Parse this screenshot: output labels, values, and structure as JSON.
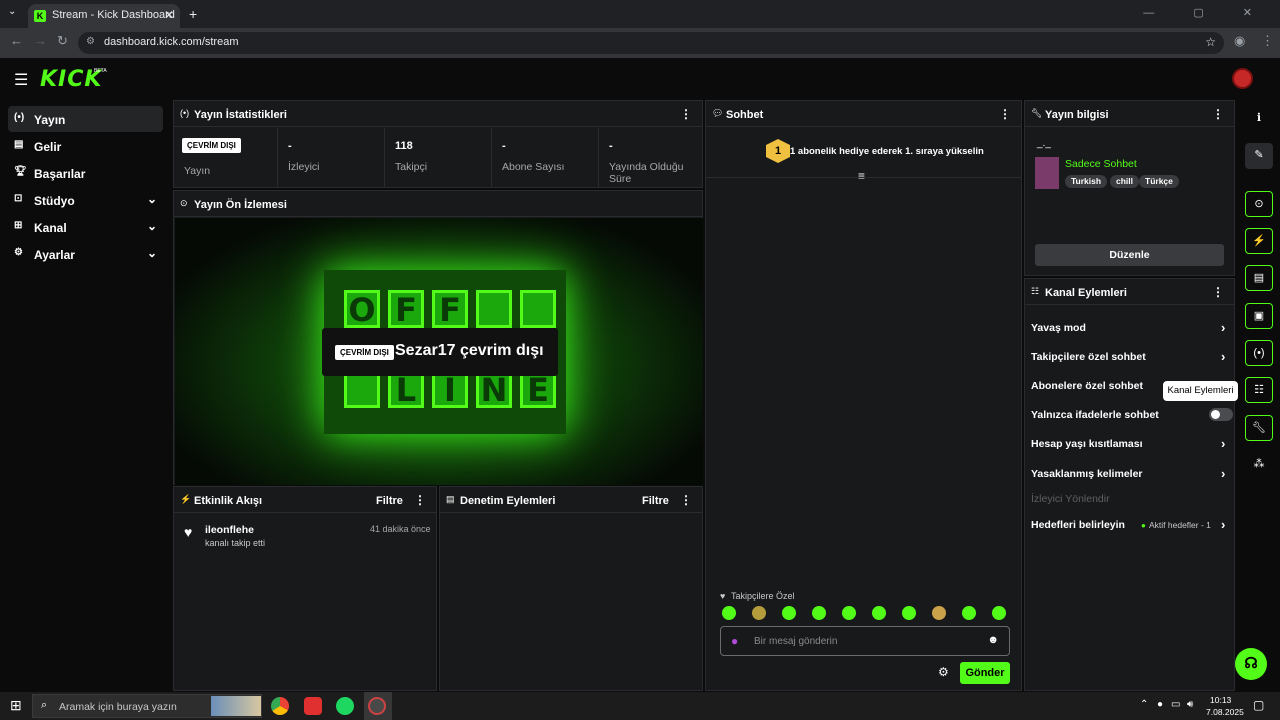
{
  "browser": {
    "tab_title": "Stream - Kick Dashboard",
    "tab_favicon": "K",
    "url": "dashboard.kick.com/stream",
    "window_controls": "— ▢ ✕"
  },
  "app": {
    "logo": "KICK",
    "logo_badge": "BETA"
  },
  "sidebar": {
    "items": [
      {
        "label": "Yayın",
        "icon": "broadcast-icon",
        "active": true,
        "expandable": false
      },
      {
        "label": "Gelir",
        "icon": "revenue-icon",
        "active": false,
        "expandable": false
      },
      {
        "label": "Başarılar",
        "icon": "trophy-icon",
        "active": false,
        "expandable": false
      },
      {
        "label": "Stüdyo",
        "icon": "studio-icon",
        "active": false,
        "expandable": true
      },
      {
        "label": "Kanal",
        "icon": "channel-icon",
        "active": false,
        "expandable": true
      },
      {
        "label": "Ayarlar",
        "icon": "gear-icon",
        "active": false,
        "expandable": true
      }
    ]
  },
  "stats": {
    "title": "Yayın İstatistikleri",
    "cells": [
      {
        "value": "ÇEVRİM DIŞI",
        "label": "Yayın"
      },
      {
        "value": "-",
        "label": "İzleyici"
      },
      {
        "value": "118",
        "label": "Takipçi"
      },
      {
        "value": "-",
        "label": "Abone Sayısı"
      },
      {
        "value": "-",
        "label": "Yayında Olduğu Süre"
      }
    ]
  },
  "preview": {
    "title": "Yayın Ön İzlemesi",
    "badge": "ÇEVRİM DIŞI",
    "message": "Sezar17 çevrim dışı",
    "sign_top": [
      "O",
      "F",
      "F",
      ""
    ],
    "sign_bottom": [
      "",
      "L",
      "I",
      "N",
      "E"
    ]
  },
  "activity": {
    "title": "Etkinlik Akışı",
    "filter": "Filtre",
    "items": [
      {
        "user": "ileonflehe",
        "action": "kanalı takip etti",
        "time": "41 dakika önce"
      }
    ]
  },
  "moderation": {
    "title": "Denetim Eylemleri",
    "filter": "Filtre"
  },
  "chat": {
    "title": "Sohbet",
    "gift_level": "1",
    "gift_text": "1 abonelik hediye ederek 1. sıraya yükselin",
    "mode_label": "Takipçilere Özel",
    "placeholder": "Bir mesaj gönderin",
    "send": "Gönder"
  },
  "stream_info": {
    "title": "Yayın bilgisi",
    "stream_title": "_._",
    "category": "Sadece Sohbet",
    "tags": [
      "Turkish",
      "chill",
      "Türkçe"
    ],
    "edit": "Düzenle"
  },
  "channel_actions": {
    "title": "Kanal Eylemleri",
    "rows": [
      {
        "label": "Yavaş mod",
        "type": "chevron"
      },
      {
        "label": "Takipçilere özel sohbet",
        "type": "chevron"
      },
      {
        "label": "Abonelere özel sohbet",
        "type": "none"
      },
      {
        "label": "Yalnızca ifadelerle sohbet",
        "type": "toggle"
      },
      {
        "label": "Hesap yaşı kısıtlaması",
        "type": "chevron"
      },
      {
        "label": "Yasaklanmış kelimeler",
        "type": "chevron"
      },
      {
        "label": "İzleyici Yönlendir",
        "type": "disabled"
      },
      {
        "label": "Hedefleri belirleyin",
        "type": "chevron",
        "status": "Aktif hedefler - 1"
      }
    ],
    "tooltip": "Kanal Eylemleri"
  },
  "taskbar": {
    "search_placeholder": "Aramak için buraya yazın",
    "time": "10:13",
    "date": "7.08.2025"
  },
  "colors": {
    "accent": "#53fc18",
    "bg": "#0b0b0c",
    "panel": "#18191b"
  }
}
